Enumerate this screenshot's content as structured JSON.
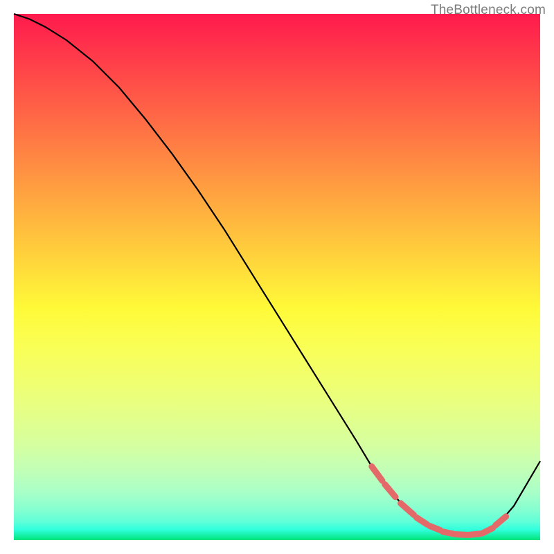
{
  "watermark": "TheBottleneck.com",
  "colors": {
    "segment_stroke": "#e46a6a",
    "curve_stroke": "#000000"
  },
  "chart_data": {
    "type": "line",
    "title": "",
    "xlabel": "",
    "ylabel": "",
    "xlim": [
      0,
      100
    ],
    "ylim": [
      0,
      100
    ],
    "series": [
      {
        "name": "bottleneck-curve",
        "x": [
          0,
          3,
          6,
          10,
          15,
          20,
          25,
          30,
          35,
          40,
          45,
          50,
          55,
          60,
          65,
          68,
          71,
          74,
          77,
          80,
          83,
          86,
          89,
          92,
          95,
          100
        ],
        "values": [
          100,
          99,
          97.5,
          95,
          91,
          86,
          80,
          73.5,
          66.5,
          59,
          51,
          43,
          35,
          27,
          19,
          14,
          10,
          6.5,
          4,
          2.3,
          1.3,
          1.0,
          1.3,
          3.0,
          6.5,
          15
        ]
      }
    ],
    "highlight_segments": [
      {
        "x": [
          68.0,
          70.0
        ],
        "y": [
          14.0,
          11.3
        ]
      },
      {
        "x": [
          70.5,
          72.5
        ],
        "y": [
          10.6,
          8.2
        ]
      },
      {
        "x": [
          73.5,
          76.0
        ],
        "y": [
          7.0,
          4.8
        ]
      },
      {
        "x": [
          76.5,
          78.5
        ],
        "y": [
          4.3,
          3.0
        ]
      },
      {
        "x": [
          79.0,
          81.0
        ],
        "y": [
          2.7,
          1.9
        ]
      },
      {
        "x": [
          81.5,
          83.5
        ],
        "y": [
          1.6,
          1.2
        ]
      },
      {
        "x": [
          84.0,
          86.0
        ],
        "y": [
          1.1,
          1.0
        ]
      },
      {
        "x": [
          86.5,
          88.5
        ],
        "y": [
          1.0,
          1.2
        ]
      },
      {
        "x": [
          89.0,
          91.0
        ],
        "y": [
          1.3,
          2.3
        ]
      },
      {
        "x": [
          91.5,
          93.5
        ],
        "y": [
          2.8,
          4.5
        ]
      }
    ]
  }
}
